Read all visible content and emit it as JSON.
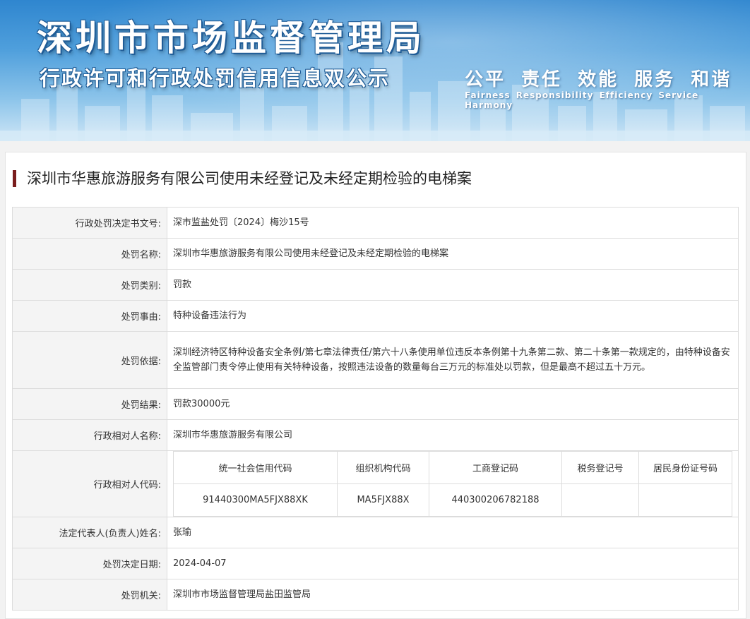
{
  "banner": {
    "title": "深圳市市场监督管理局",
    "subtitle": "行政许可和行政处罚信用信息双公示",
    "slogan_cn": "公平 责任 效能 服务 和谐",
    "slogan_en": "Fairness Responsibility Efficiency Service Harmony"
  },
  "case_title": "深圳市华惠旅游服务有限公司使用未经登记及未经定期检验的电梯案",
  "rows": [
    {
      "label": "行政处罚决定书文号:",
      "value": "深市监盐处罚〔2024〕梅沙15号"
    },
    {
      "label": "处罚名称:",
      "value": "深圳市华惠旅游服务有限公司使用未经登记及未经定期检验的电梯案"
    },
    {
      "label": "处罚类别:",
      "value": "罚款"
    },
    {
      "label": "处罚事由:",
      "value": "特种设备违法行为"
    },
    {
      "label": "处罚依据:",
      "value": "深圳经济特区特种设备安全条例/第七章法律责任/第六十八条使用单位违反本条例第十九条第二款、第二十条第一款规定的，由特种设备安全监管部门责令停止使用有关特种设备，按照违法设备的数量每台三万元的标准处以罚款，但是最高不超过五十万元。"
    },
    {
      "label": "处罚结果:",
      "value": "罚款30000元"
    },
    {
      "label": "行政相对人名称:",
      "value": "深圳市华惠旅游服务有限公司"
    }
  ],
  "codes": {
    "label": "行政相对人代码:",
    "headers": [
      "统一社会信用代码",
      "组织机构代码",
      "工商登记码",
      "税务登记号",
      "居民身份证号码"
    ],
    "values": [
      "91440300MA5FJX88XK",
      "MA5FJX88X",
      "440300206782188",
      "",
      ""
    ]
  },
  "rows_after": [
    {
      "label": "法定代表人(负责人)姓名:",
      "value": "张瑜"
    },
    {
      "label": "处罚决定日期:",
      "value": "2024-04-07"
    },
    {
      "label": "处罚机关:",
      "value": "深圳市市场监督管理局盐田监管局"
    }
  ]
}
